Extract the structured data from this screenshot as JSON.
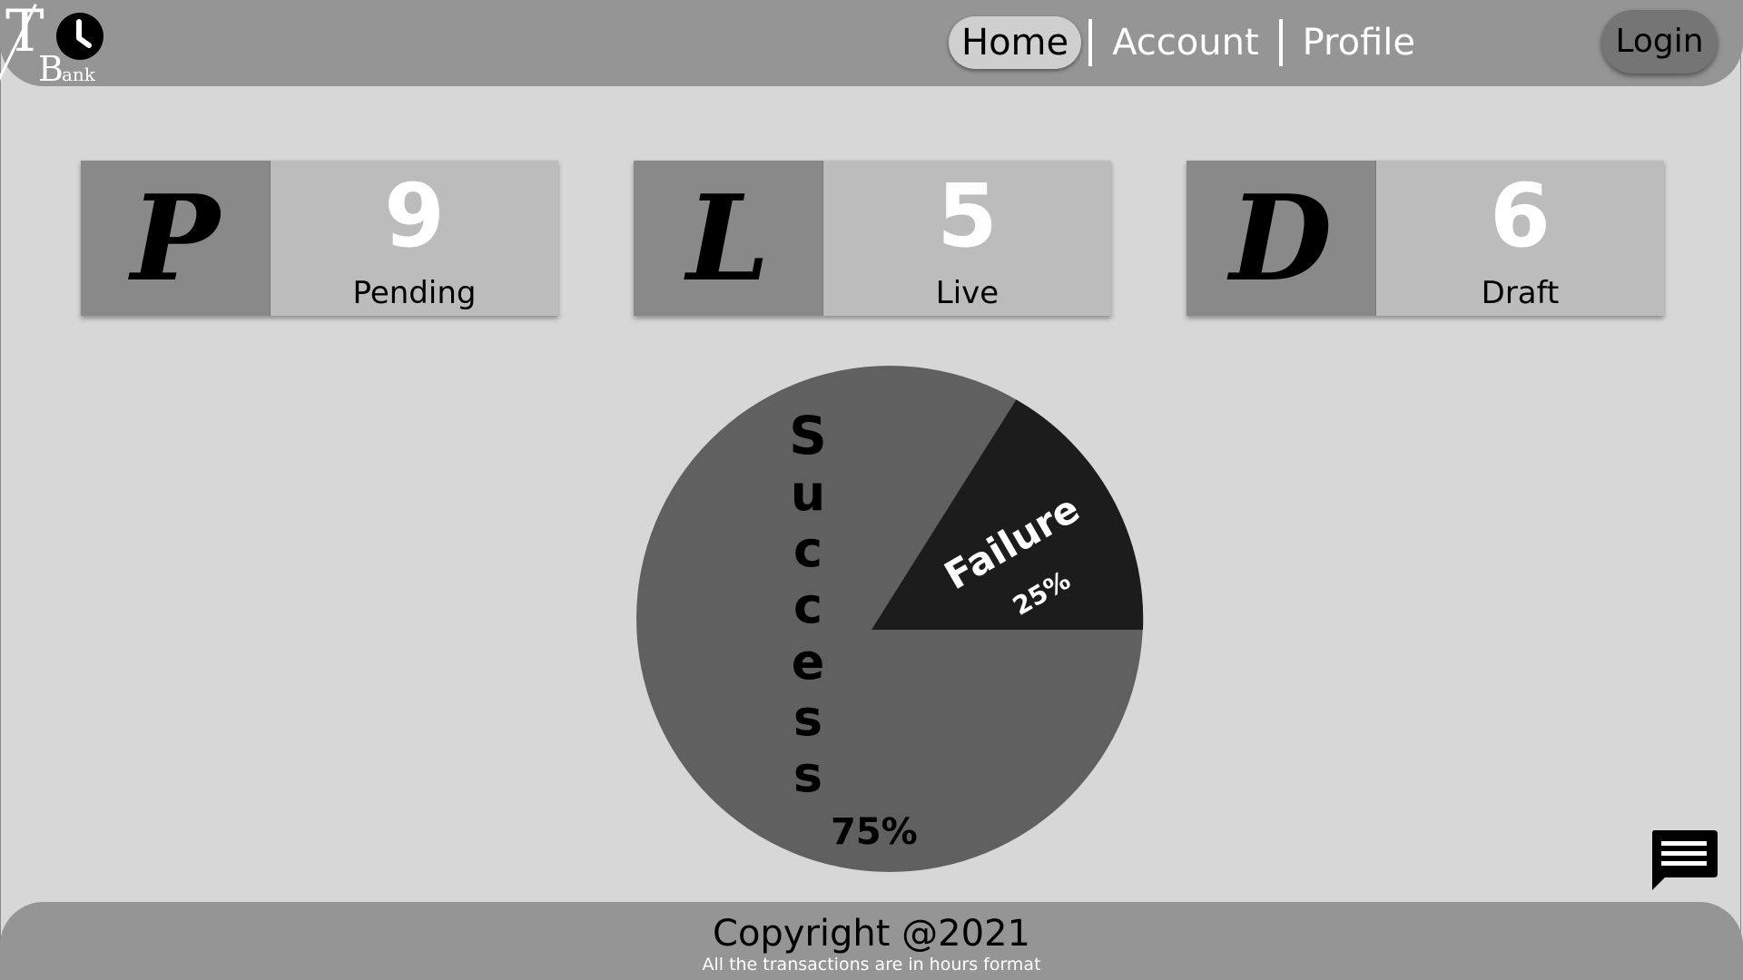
{
  "brand": {
    "logo_letter_t": "T",
    "logo_letter_b": "B",
    "logo_suffix": "ank"
  },
  "nav": {
    "items": [
      {
        "label": "Home",
        "active": true
      },
      {
        "label": "Account",
        "active": false
      },
      {
        "label": "Profile",
        "active": false
      }
    ],
    "login_label": "Login"
  },
  "cards": [
    {
      "glyph": "P",
      "count": "9",
      "label": "Pending"
    },
    {
      "glyph": "L",
      "count": "5",
      "label": "Live"
    },
    {
      "glyph": "D",
      "count": "6",
      "label": "Draft"
    }
  ],
  "chart_data": {
    "type": "pie",
    "slices": [
      {
        "label": "Success",
        "value": 75,
        "value_label": "75%",
        "color": "#606060"
      },
      {
        "label": "Failure",
        "value": 25,
        "value_label": "25%",
        "color": "#1c1c1c"
      }
    ]
  },
  "chat": {
    "icon": "chat-icon"
  },
  "footer": {
    "copyright": "Copyright @2021",
    "note": "All the transactions are in hours format"
  },
  "colors": {
    "header_bg": "#959595",
    "page_bg": "#d7d7d7",
    "card_left_bg": "#898989",
    "card_right_bg": "#bcbcbc",
    "login_bg": "#757575"
  }
}
